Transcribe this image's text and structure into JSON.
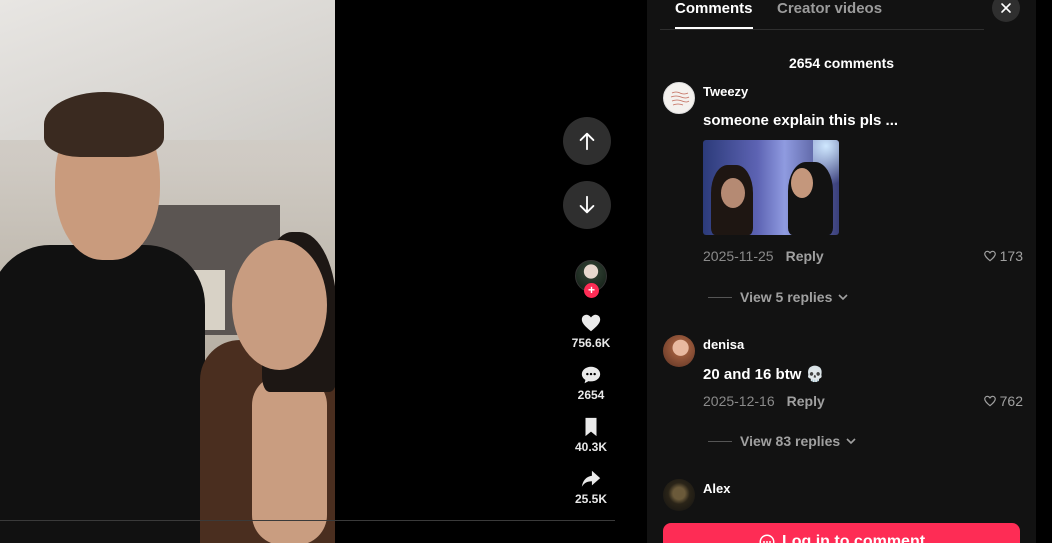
{
  "video": {
    "nav_up_icon": "arrow-up-icon",
    "nav_down_icon": "arrow-down-icon"
  },
  "actions": {
    "likes": "756.6K",
    "comments": "2654",
    "saves": "40.3K",
    "shares": "25.5K"
  },
  "panel": {
    "tabs": [
      {
        "label": "Comments",
        "active": true
      },
      {
        "label": "Creator videos",
        "active": false
      }
    ],
    "comment_count": "2654 comments",
    "comments": [
      {
        "user": "Tweezy",
        "text": "someone explain this pls ...",
        "date": "2025-11-25",
        "reply_label": "Reply",
        "likes": "173",
        "view_replies": "View 5 replies"
      },
      {
        "user": "denisa",
        "text": "20 and 16 btw 💀",
        "date": "2025-12-16",
        "reply_label": "Reply",
        "likes": "762",
        "view_replies": "View 83 replies"
      },
      {
        "user": "Alex"
      }
    ],
    "login_label": "Log in to comment"
  },
  "colors": {
    "accent": "#fe2c55",
    "panel_bg": "#121212"
  }
}
